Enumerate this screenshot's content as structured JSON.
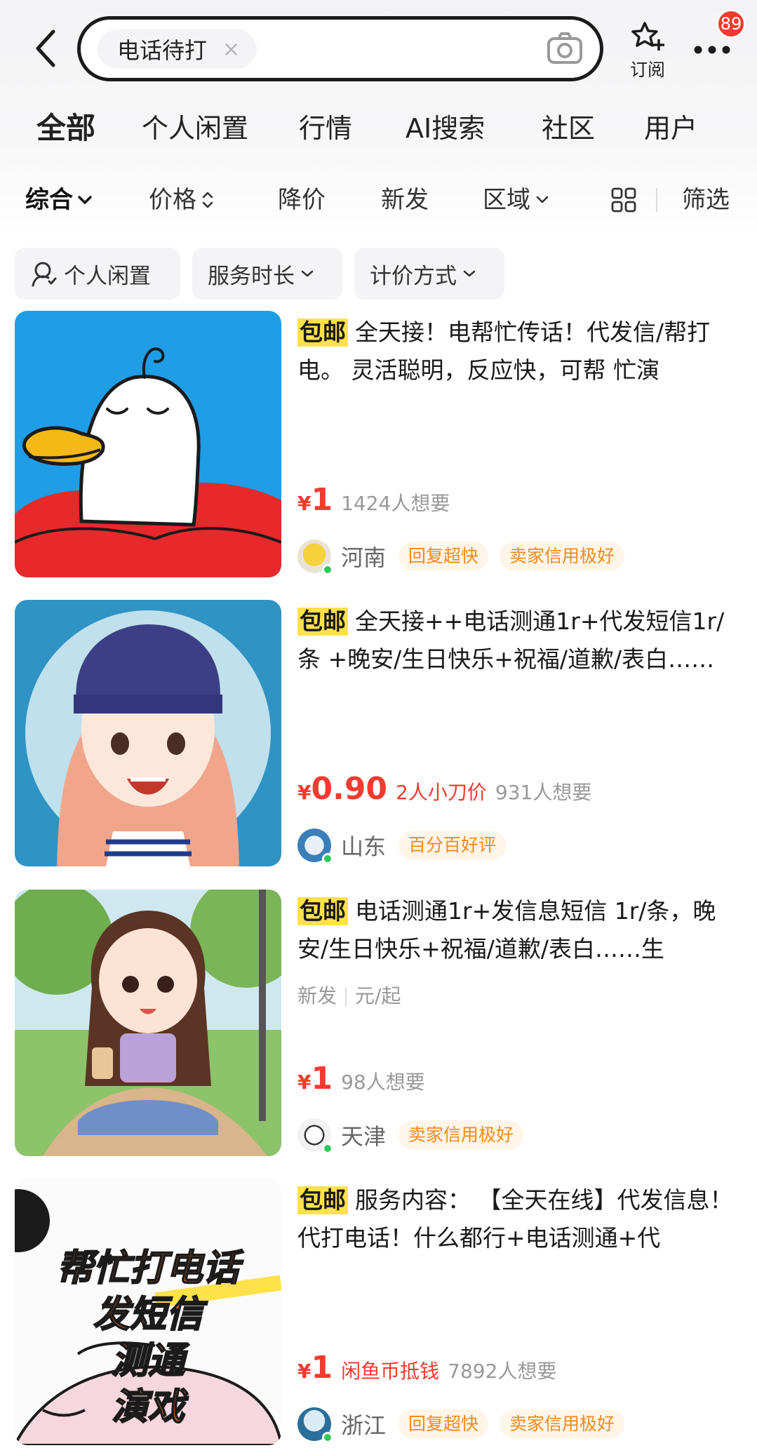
{
  "search": {
    "query": "电话待打",
    "clear_symbol": "×"
  },
  "header": {
    "subscribe_label": "订阅",
    "badge_count": "89"
  },
  "tabs": [
    {
      "label": "全部",
      "active": true
    },
    {
      "label": "个人闲置"
    },
    {
      "label": "行情"
    },
    {
      "label": "AI搜索"
    },
    {
      "label": "社区"
    },
    {
      "label": "用户"
    }
  ],
  "sort": {
    "comprehensive": "综合",
    "price": "价格",
    "price_drop": "降价",
    "newest": "新发",
    "region": "区域",
    "filter": "筛选"
  },
  "filters": {
    "personal_idle": "个人闲置",
    "service_duration": "服务时长",
    "pricing_method": "计价方式"
  },
  "listings": [
    {
      "tag": "包邮",
      "title": "全天接！电帮忙传话！代发信/帮打电。 灵活聪明，反应快，可帮 忙演",
      "currency": "¥",
      "price": "1",
      "want": "1424人想要",
      "region": "河南",
      "seller_tags": [
        "回复超快",
        "卖家信用极好"
      ]
    },
    {
      "tag": "包邮",
      "title": "全天接++电话测通1r+代发短信1r/条 +晚安/生日快乐+祝福/道歉/表白……",
      "currency": "¥",
      "price": "0.90",
      "promo": "2人小刀价",
      "want": "931人想要",
      "region": "山东",
      "seller_tags": [
        "百分百好评"
      ]
    },
    {
      "tag": "包邮",
      "title": "电话测通1r+发信息短信 1r/条，晚安/生日快乐+祝福/道歉/表白……生",
      "meta_new": "新发",
      "meta_unit": "元/起",
      "currency": "¥",
      "price": "1",
      "want": "98人想要",
      "region": "天津",
      "seller_tags": [
        "卖家信用极好"
      ]
    },
    {
      "tag": "包邮",
      "title": "服务内容： 【全天在线】代发信息！代打电话！什么都行+电话测通+代",
      "currency": "¥",
      "price": "1",
      "promo": "闲鱼币抵钱",
      "want": "7892人想要",
      "region": "浙江",
      "seller_tags": [
        "回复超快",
        "卖家信用极好"
      ],
      "image_text": [
        "帮忙打电话",
        "发短信",
        "测通",
        "演戏"
      ]
    }
  ],
  "colors": {
    "accent_yellow": "#ffe14a",
    "price_red": "#f23b2f",
    "seller_tag_orange": "#f08a1f"
  }
}
